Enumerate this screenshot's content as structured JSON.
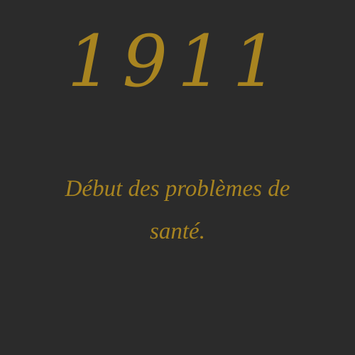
{
  "title": {
    "year": "1911"
  },
  "caption": {
    "text": "Début des problèmes de santé."
  },
  "colors": {
    "background": "#2b2b2b",
    "text": "#a88420"
  }
}
